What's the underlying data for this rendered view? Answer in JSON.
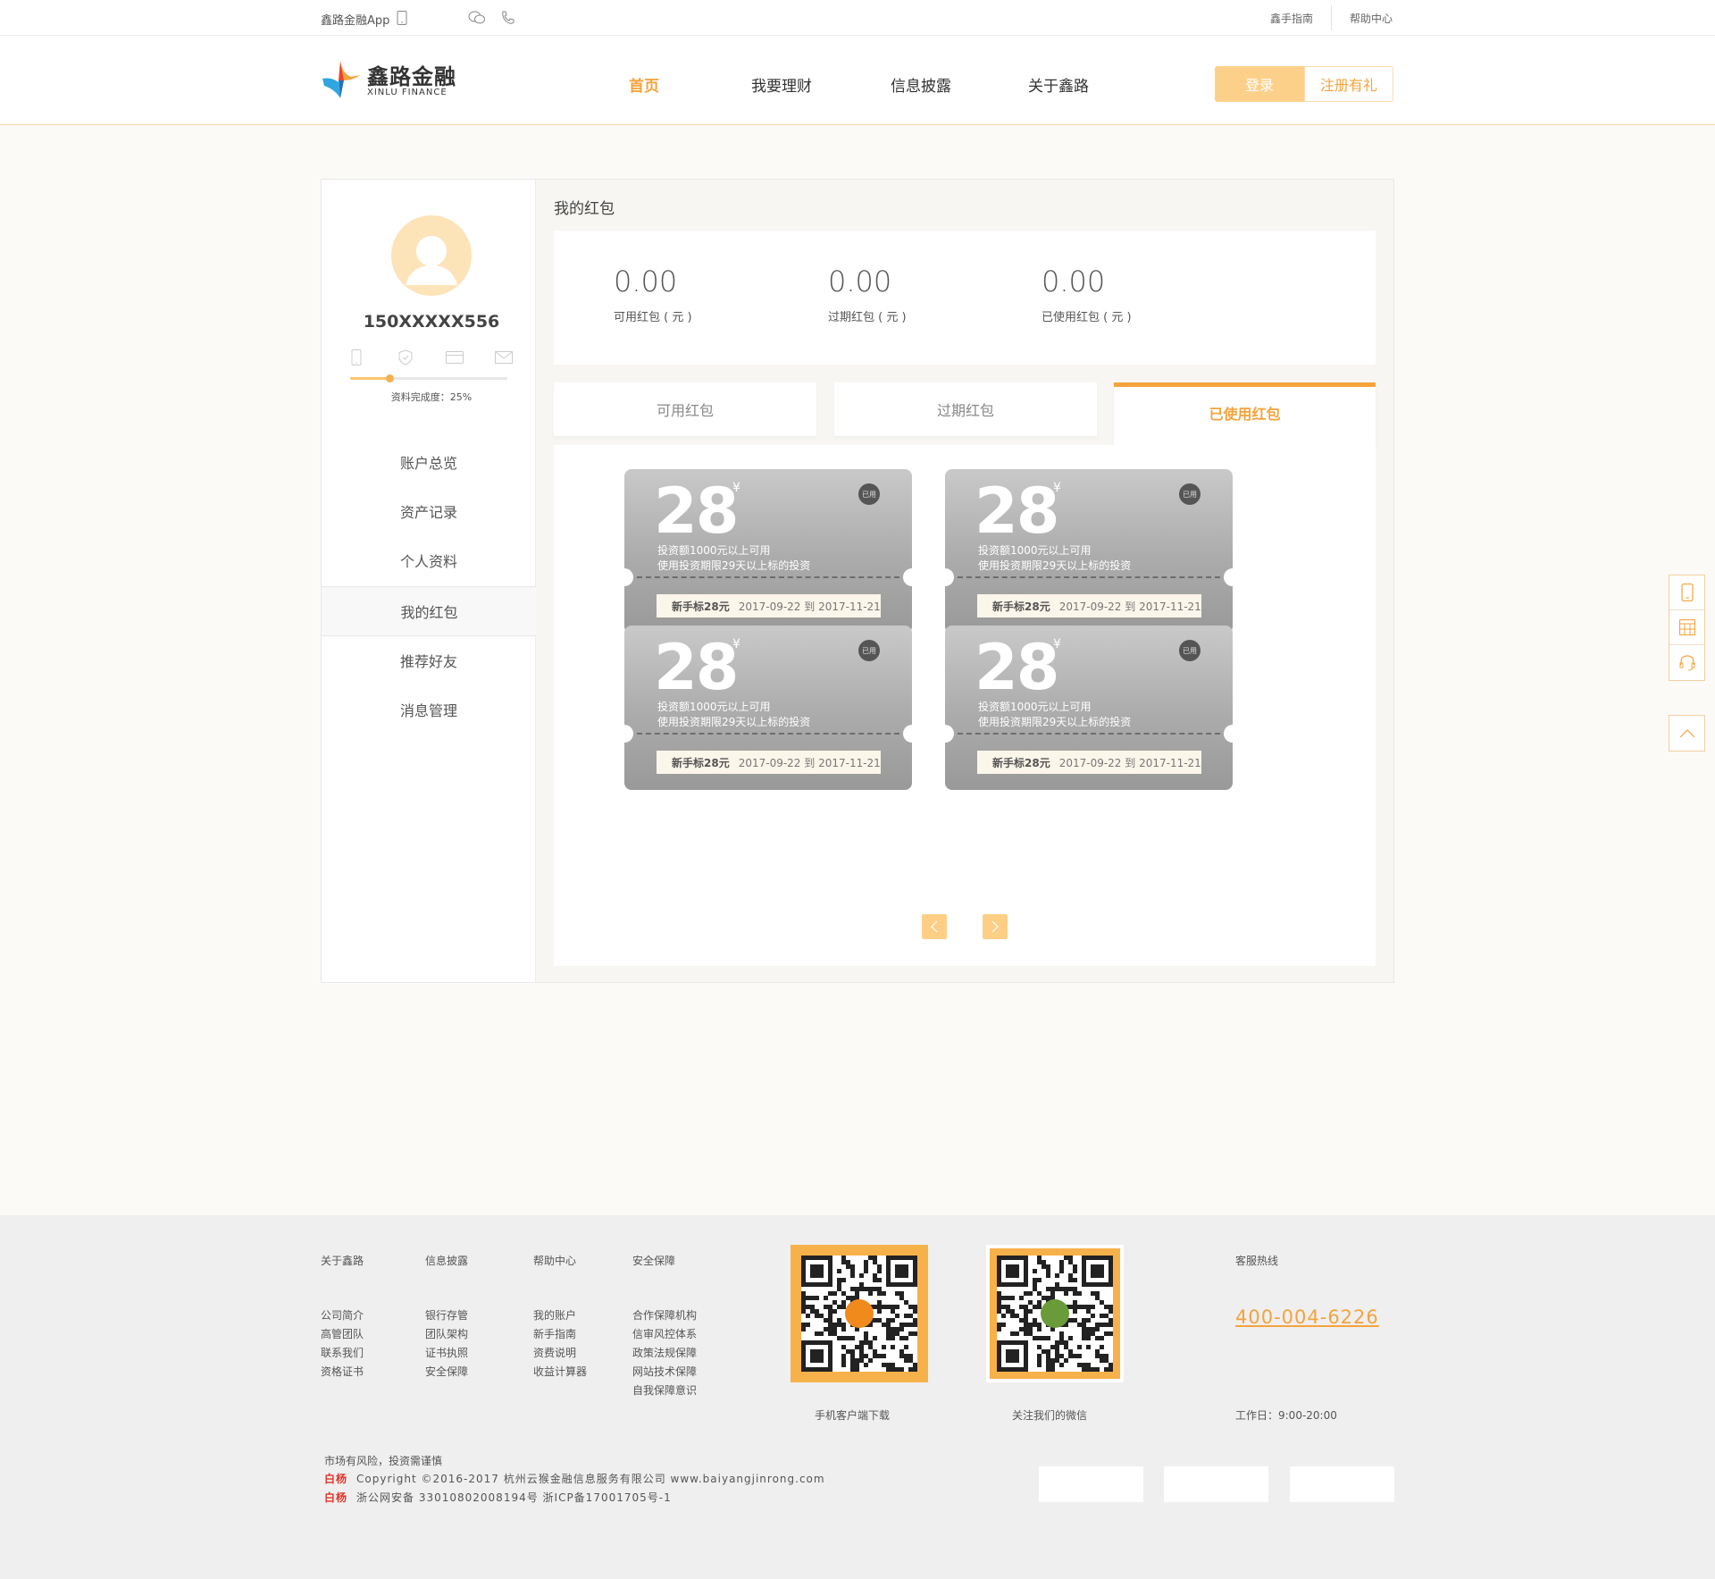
{
  "topbar": {
    "app_label": "鑫路金融App",
    "guide": "鑫手指南",
    "help": "帮助中心"
  },
  "header": {
    "logo_cn": "鑫路金融",
    "logo_en": "XINLU FINANCE",
    "nav": [
      "首页",
      "我要理财",
      "信息披露",
      "关于鑫路"
    ],
    "active_nav": "首页",
    "login": "登录",
    "register": "注册有礼"
  },
  "sidebar": {
    "username": "150XXXXX556",
    "profile_completion": "资料完成度：25%",
    "completion_fraction": 0.25,
    "menu": [
      "账户总览",
      "资产记录",
      "个人资料",
      "我的红包",
      "推荐好友",
      "消息管理"
    ],
    "active_menu": "我的红包"
  },
  "content": {
    "title": "我的红包",
    "stats": [
      {
        "value": "0.00",
        "label": "可用红包 ( 元 )"
      },
      {
        "value": "0.00",
        "label": "过期红包 ( 元 )"
      },
      {
        "value": "0.00",
        "label": "已使用红包 ( 元 )"
      }
    ],
    "tabs": [
      "可用红包",
      "过期红包",
      "已使用红包"
    ],
    "active_tab": "已使用红包",
    "coupon_template": {
      "amount": "28",
      "currency": "¥",
      "badge": "已用",
      "desc1": "投资额1000元以上可用",
      "desc2": "使用投资期限29天以上标的投资",
      "name": "新手标28元",
      "period": "2017-09-22 到 2017-11-21"
    },
    "coupons": [
      {
        "amount": "28",
        "currency": "¥",
        "badge": "已用",
        "desc1": "投资额1000元以上可用",
        "desc2": "使用投资期限29天以上标的投资",
        "name": "新手标28元",
        "period": "2017-09-22 到 2017-11-21"
      },
      {
        "amount": "28",
        "currency": "¥",
        "badge": "已用",
        "desc1": "投资额1000元以上可用",
        "desc2": "使用投资期限29天以上标的投资",
        "name": "新手标28元",
        "period": "2017-09-22 到 2017-11-21"
      },
      {
        "amount": "28",
        "currency": "¥",
        "badge": "已用",
        "desc1": "投资额1000元以上可用",
        "desc2": "使用投资期限29天以上标的投资",
        "name": "新手标28元",
        "period": "2017-09-22 到 2017-11-21"
      },
      {
        "amount": "28",
        "currency": "¥",
        "badge": "已用",
        "desc1": "投资额1000元以上可用",
        "desc2": "使用投资期限29天以上标的投资",
        "name": "新手标28元",
        "period": "2017-09-22 到 2017-11-21"
      }
    ]
  },
  "footer": {
    "columns": [
      {
        "title": "关于鑫路",
        "links": [
          "公司简介",
          "高管团队",
          "联系我们",
          "资格证书"
        ]
      },
      {
        "title": "信息披露",
        "links": [
          "银行存管",
          "团队架构",
          "证书执照",
          "安全保障"
        ]
      },
      {
        "title": "帮助中心",
        "links": [
          "我的账户",
          "新手指南",
          "资费说明",
          "收益计算器"
        ]
      },
      {
        "title": "安全保障",
        "links": [
          "合作保障机构",
          "信审风控体系",
          "政策法规保障",
          "网站技术保障",
          "自我保障意识"
        ]
      }
    ],
    "qr_app_caption": "手机客户端下载",
    "qr_wechat_caption": "关注我们的微信",
    "hotline_title": "客服热线",
    "hotline": "400-004-6226",
    "worktime": "工作日：9:00-20:00",
    "risk": "市场有风险，投资需谨慎",
    "brand": "白杨",
    "copyright": "Copyright ©2016-2017 杭州云猴金融信息服务有限公司 www.baiyangjinrong.com",
    "icp": "浙公网安备 33010802008194号 浙ICP备17001705号-1"
  },
  "colors": {
    "accent": "#f5a33c",
    "accent_light": "#fdd08a",
    "coupon_gray": "#a9a9a9"
  },
  "icons": [
    "phone-icon",
    "wechat-icon",
    "telephone-icon",
    "mobile-verify-icon",
    "shield-icon",
    "card-icon",
    "mail-icon",
    "calculator-icon",
    "headset-icon",
    "arrow-up-icon",
    "chevron-left-icon",
    "chevron-right-icon"
  ]
}
